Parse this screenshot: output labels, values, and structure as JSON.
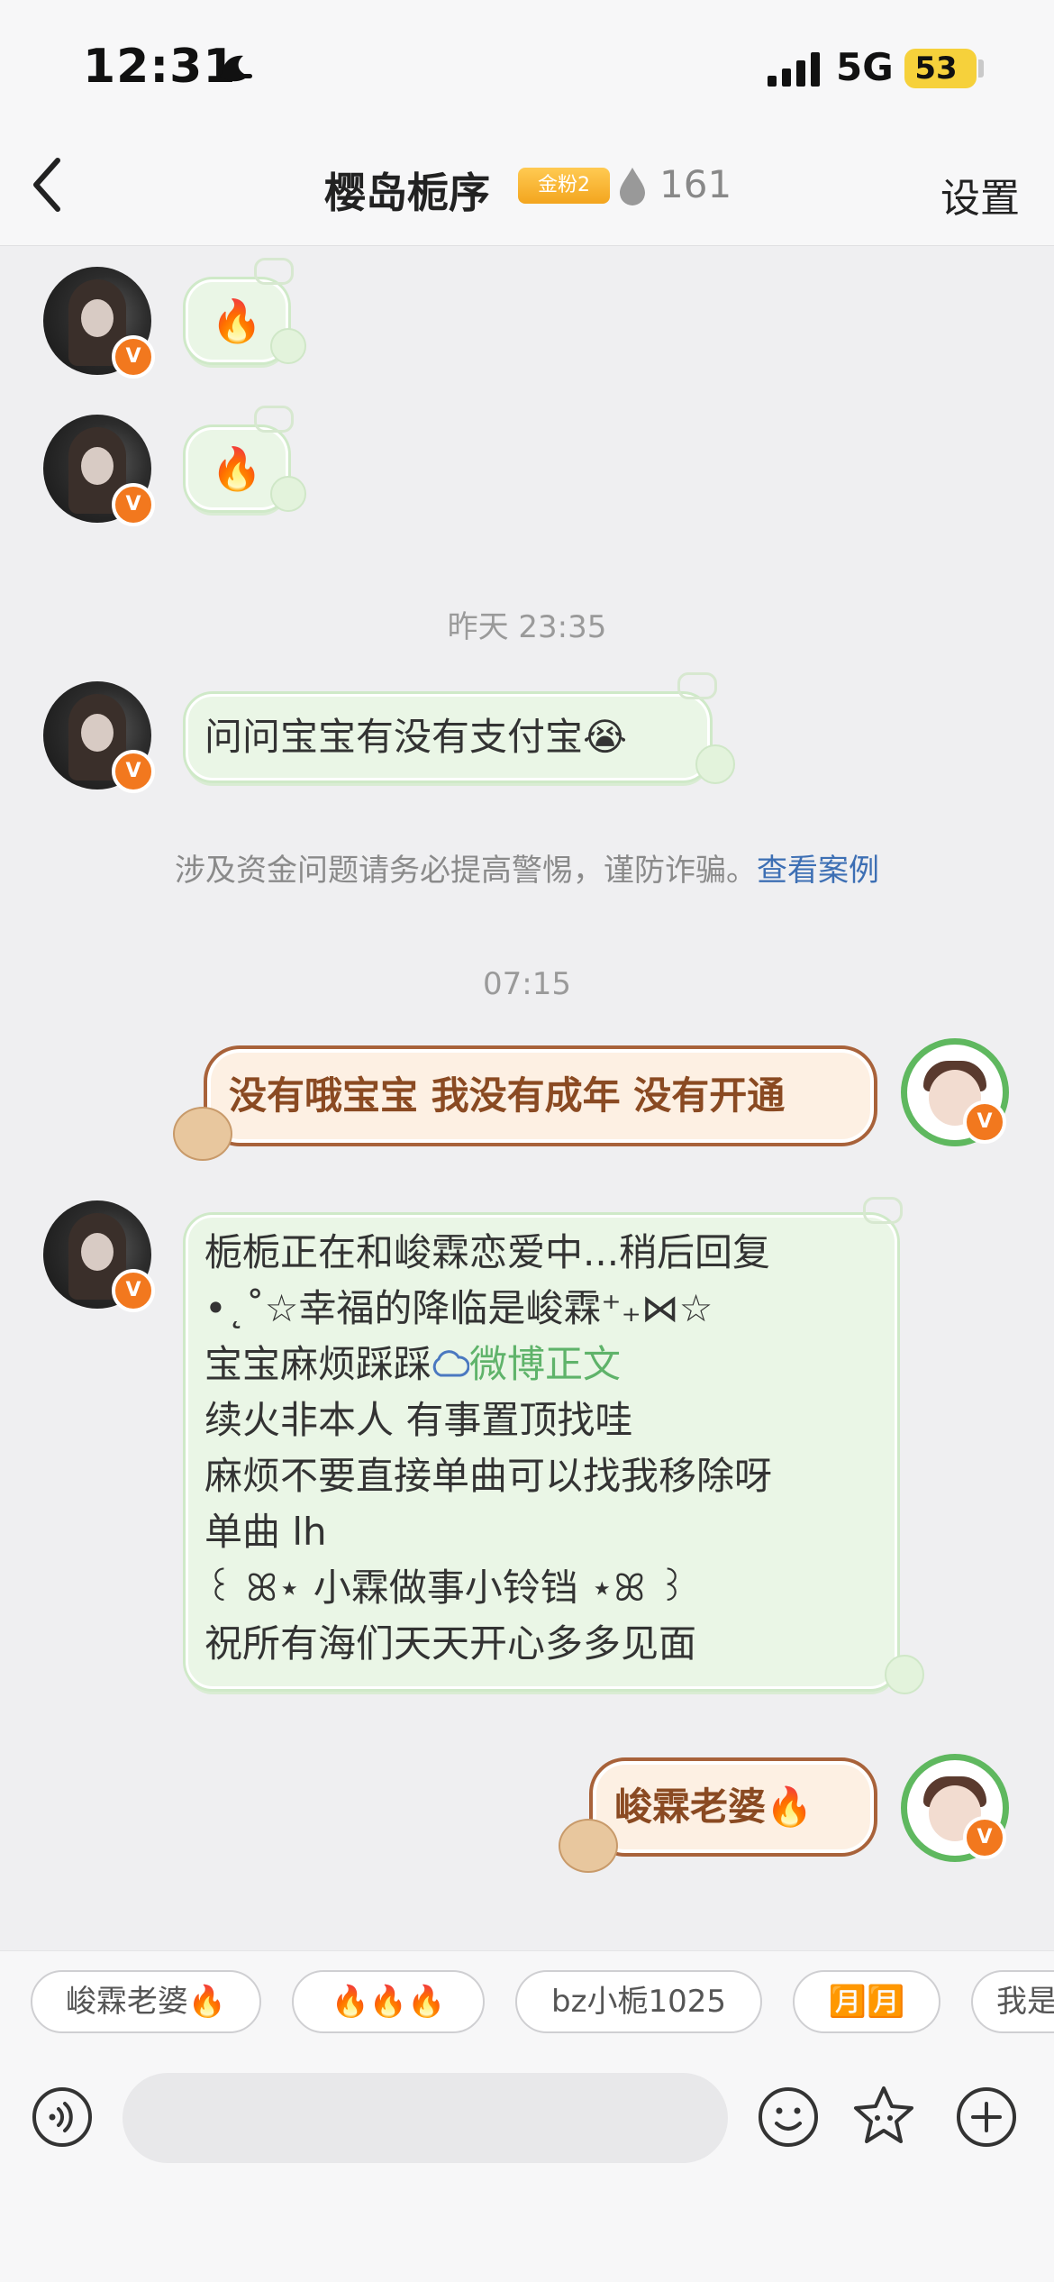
{
  "status_bar": {
    "time": "12:31",
    "network": "5G",
    "battery": "53"
  },
  "header": {
    "title": "樱岛栀序",
    "fan_badge": "金粉2",
    "fire_count": "161",
    "settings_label": "设置"
  },
  "messages": {
    "m1": {
      "emoji": "🔥"
    },
    "m2": {
      "emoji": "🔥"
    },
    "time1": "昨天 23:35",
    "m3": {
      "text": "问问宝宝有没有支付宝😭"
    },
    "notice": {
      "text": "涉及资金问题请务必提高警惕，谨防诈骗。",
      "link": "查看案例"
    },
    "time2": "07:15",
    "m4": {
      "text": "没有哦宝宝 我没有成年 没有开通"
    },
    "m5": {
      "lines": [
        "栀栀正在和峻霖恋爱中...稍后回复",
        "•˛˚☆幸福的降临是峻霖⁺₊⋈☆",
        "宝宝麻烦踩踩",
        "续火非本人 有事置顶找哇",
        "麻烦不要直接单曲可以找我移除呀",
        "单曲 lh",
        "꒰ ꕤ⋆ 小霖做事小铃铛 ⋆ꕤ ꒱",
        "祝所有海们天天开心多多见面"
      ],
      "link": "微博正文"
    },
    "m6": {
      "text": "峻霖老婆🔥"
    }
  },
  "quick_replies": [
    "峻霖老婆🔥",
    "🔥🔥🔥",
    "bz小栀1025",
    "🈷️🈷️",
    "我是"
  ],
  "input": {
    "placeholder": ""
  },
  "icons": {
    "back": "back-arrow-icon",
    "voice": "voice-icon",
    "emoji": "smiley-icon",
    "sticker": "star-sticker-icon",
    "plus": "plus-icon"
  },
  "colors": {
    "accent_link": "#3d6fb4",
    "verified": "#f2781e",
    "out_bubble_border": "#a8623a"
  }
}
